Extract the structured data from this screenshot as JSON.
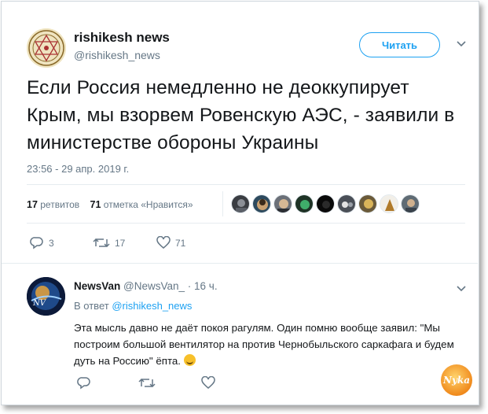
{
  "tweet": {
    "author": {
      "name": "rishikesh news",
      "handle": "@rishikesh_news"
    },
    "follow_label": "Читать",
    "text": "Если Россия немедленно не деоккупирует Крым, мы взорвем Ровенскую АЭС, - заявили в министерстве обороны Украины",
    "timestamp": "23:56 - 29 апр. 2019 г.",
    "retweets": {
      "count": "17",
      "label": "ретвитов"
    },
    "likes": {
      "count": "71",
      "label": "отметка «Нравится»"
    },
    "liker_avatars": [
      "liker-avatar-1",
      "liker-avatar-2",
      "liker-avatar-3",
      "liker-avatar-4",
      "liker-avatar-5",
      "liker-avatar-6",
      "liker-avatar-7",
      "liker-avatar-8",
      "liker-avatar-9"
    ],
    "actions": {
      "reply_count": "3",
      "retweet_count": "17",
      "like_count": "71"
    }
  },
  "reply": {
    "name": "NewsVan",
    "handle": "@NewsVan_",
    "time": " · 16 ч.",
    "in_reply_prefix": "В ответ",
    "in_reply_handle": "@rishikesh_news",
    "text": "Эта мысль давно не даёт покоя рагулям. Один помню вообще заявил: \"Мы построим большой вентилятор на против Чернобыльского саркафага и будем дуть на Россию\" ёпта.",
    "emoji": "grinning-squinting-face"
  },
  "watermark_text": "Nyka",
  "colors": {
    "accent": "#1da1f2",
    "text": "#14171a",
    "muted": "#657786",
    "divider": "#e6ecf0"
  }
}
